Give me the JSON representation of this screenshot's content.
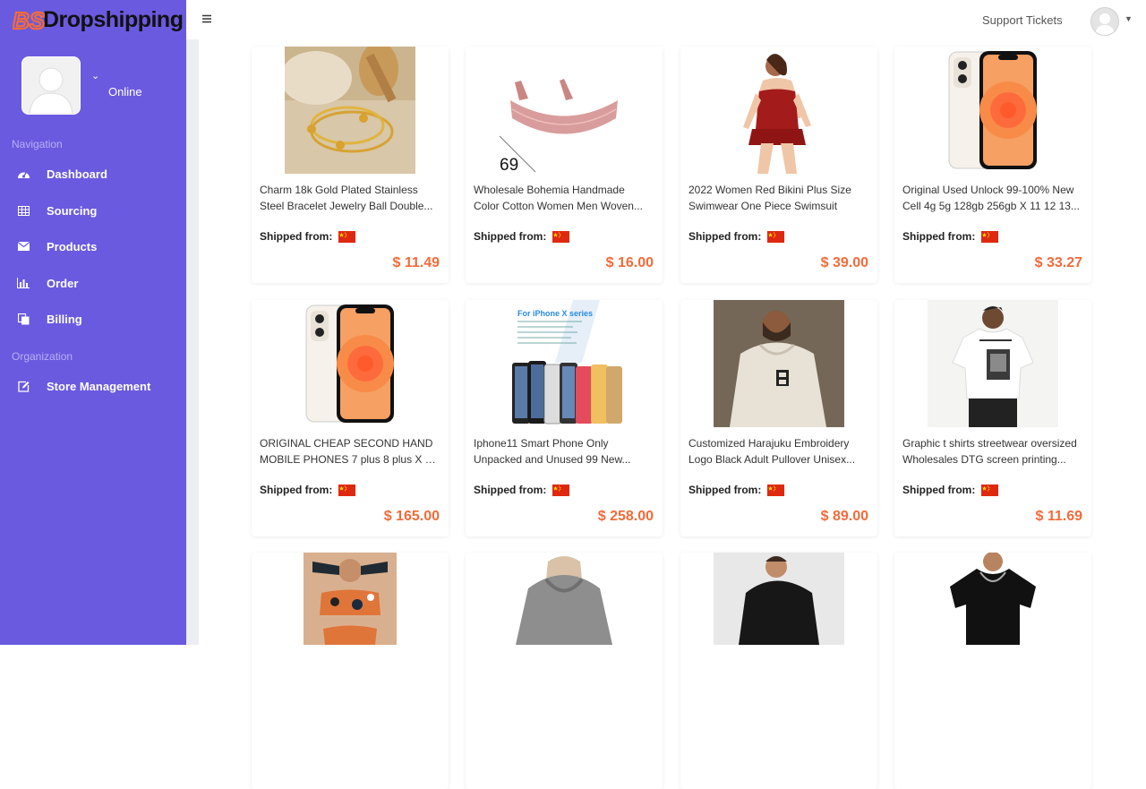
{
  "brand": {
    "name": "Dropshipping",
    "logo_text": "BS"
  },
  "user": {
    "status": "Online"
  },
  "sidebar": {
    "sections": [
      {
        "label": "Navigation"
      },
      {
        "label": "Organization"
      }
    ],
    "items": [
      {
        "label": "Dashboard",
        "icon": "dashboard-icon"
      },
      {
        "label": "Sourcing",
        "icon": "grid-icon"
      },
      {
        "label": "Products",
        "icon": "envelope-icon"
      },
      {
        "label": "Order",
        "icon": "bar-chart-icon"
      },
      {
        "label": "Billing",
        "icon": "copy-icon"
      },
      {
        "label": "Store Management",
        "icon": "edit-icon"
      }
    ]
  },
  "header": {
    "support_label": "Support Tickets"
  },
  "ship_label": "Shipped from:",
  "products": [
    {
      "title1": "Charm 18k Gold Plated Stainless",
      "title2": "Steel Bracelet Jewelry Ball Double...",
      "price": "$ 11.49",
      "image": "gold-bracelet"
    },
    {
      "title1": "Wholesale Bohemia Handmade",
      "title2": "Color Cotton Women Men Woven...",
      "price": "$ 16.00",
      "image": "woven-bracelet",
      "overlay": "69"
    },
    {
      "title1": "2022 Women Red Bikini Plus Size",
      "title2": "Swimwear One Piece Swimsuit",
      "price": "$ 39.00",
      "image": "red-swimsuit"
    },
    {
      "title1": "Original Used Unlock 99-100% New",
      "title2": "Cell 4g 5g 128gb 256gb X 11 12 13...",
      "price": "$ 33.27",
      "image": "iphone"
    },
    {
      "title1": "ORIGINAL CHEAP SECOND HAND",
      "title2": "MOBILE PHONES 7 plus 8 plus X X...",
      "price": "$ 165.00",
      "image": "iphone"
    },
    {
      "title1": "Iphone11 Smart Phone Only",
      "title2": "Unpacked and Unused 99 New...",
      "price": "$ 258.00",
      "image": "phone-lineup",
      "banner": "For iPhone X series"
    },
    {
      "title1": "Customized Harajuku Embroidery",
      "title2": "Logo Black Adult Pullover Unisex...",
      "price": "$ 89.00",
      "image": "beige-hoodie"
    },
    {
      "title1": "Graphic t shirts streetwear oversized",
      "title2": "Wholesales DTG screen printing...",
      "price": "$ 11.69",
      "image": "graphic-tee"
    },
    {
      "title1": "",
      "title2": "",
      "price": "",
      "image": "swim-top"
    },
    {
      "title1": "",
      "title2": "",
      "price": "",
      "image": "grey-hoodie"
    },
    {
      "title1": "",
      "title2": "",
      "price": "",
      "image": "black-hoodie"
    },
    {
      "title1": "",
      "title2": "",
      "price": "",
      "image": "black-tee"
    }
  ],
  "colors": {
    "sidebar": "#6a5ae0",
    "price": "#f26b3a",
    "flag_red": "#de2910",
    "flag_yellow": "#ffde00"
  }
}
